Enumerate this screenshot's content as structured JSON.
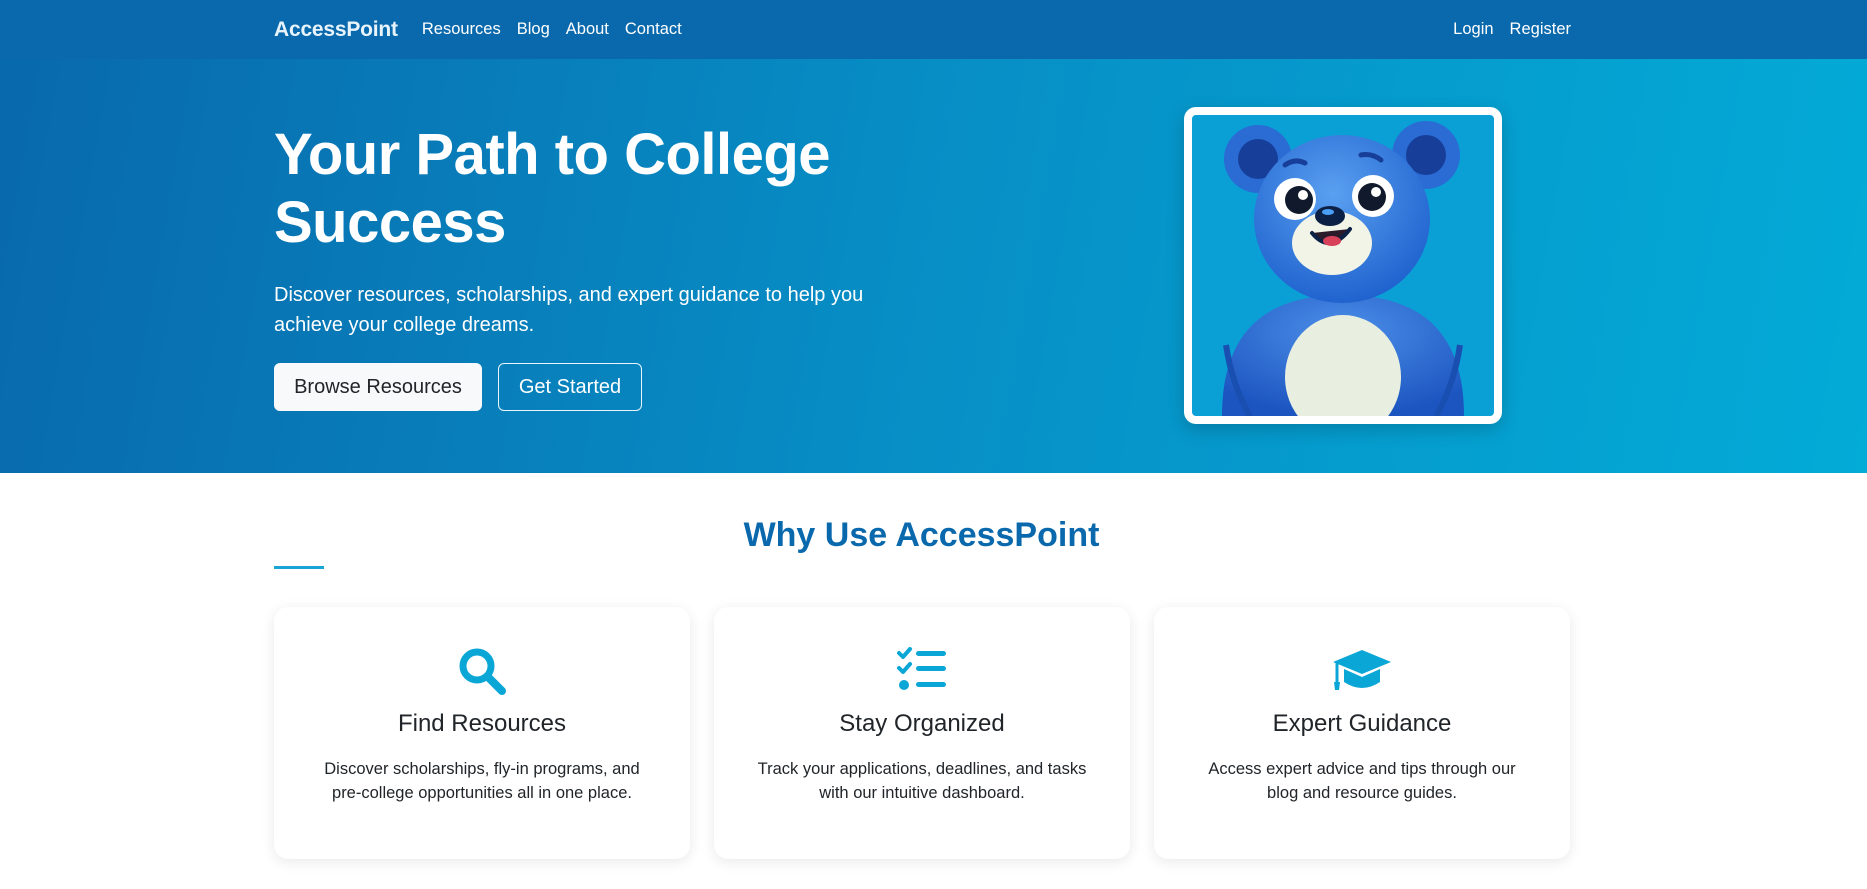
{
  "nav": {
    "brand": "AccessPoint",
    "links": [
      "Resources",
      "Blog",
      "About",
      "Contact"
    ],
    "auth": [
      "Login",
      "Register"
    ]
  },
  "hero": {
    "title": "Your Path to College Success",
    "subtitle": "Discover resources, scholarships, and expert guidance to help you achieve your college dreams.",
    "browse_label": "Browse Resources",
    "start_label": "Get Started",
    "mascot": "blue-bear-mascot"
  },
  "features": {
    "title": "Why Use AccessPoint",
    "cards": [
      {
        "icon": "search-icon",
        "title": "Find Resources",
        "text": "Discover scholarships, fly-in programs, and pre-college opportunities all in one place."
      },
      {
        "icon": "checklist-icon",
        "title": "Stay Organized",
        "text": "Track your applications, deadlines, and tasks with our intuitive dashboard."
      },
      {
        "icon": "graduation-cap-icon",
        "title": "Expert Guidance",
        "text": "Access expert advice and tips through our blog and resource guides."
      }
    ]
  },
  "colors": {
    "nav_bg": "#0a69ac",
    "hero_gradient_start": "#0869ac",
    "hero_gradient_end": "#03abd7",
    "accent": "#0aa7d6",
    "section_title": "#0a69ac"
  }
}
